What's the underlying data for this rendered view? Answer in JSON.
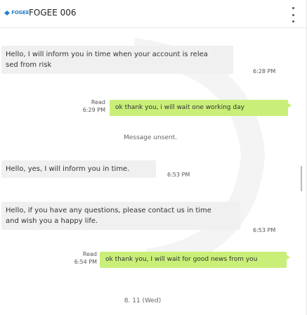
{
  "header": {
    "logo_text": "FOGEE",
    "title": "FOGEE 006"
  },
  "messages": [
    {
      "kind": "in",
      "lines": [
        "Hello, I will inform you in time when your account is relea",
        "sed from risk"
      ],
      "time": "6:28 PM"
    },
    {
      "kind": "out",
      "status": "Read",
      "time": "6:29 PM",
      "text": "ok thank you, i will wait one working day"
    },
    {
      "kind": "system",
      "text": "Message unsent."
    },
    {
      "kind": "in",
      "lines": [
        "Hello, yes, I will inform you in time."
      ],
      "time": "6:53 PM"
    },
    {
      "kind": "in",
      "lines": [
        "Hello, if you have any questions, please contact us in time",
        "and wish you a happy life."
      ],
      "time": "6:53 PM"
    },
    {
      "kind": "out",
      "status": "Read",
      "time": "6:54 PM",
      "text": "ok thank you, I will wait for good news from you"
    },
    {
      "kind": "date",
      "text": "8. 11 (Wed)"
    }
  ],
  "colors": {
    "outgoing_bubble": "#c9ef79",
    "incoming_bubble": "#f0f0f0",
    "logo": "#2a7fc9"
  }
}
